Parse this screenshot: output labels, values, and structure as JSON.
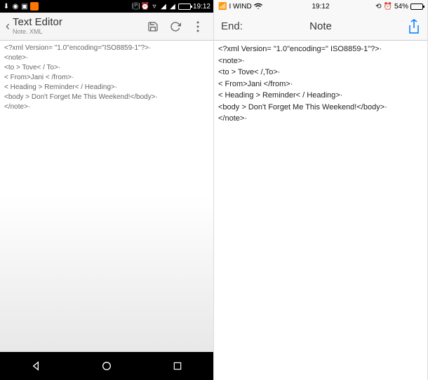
{
  "android": {
    "status": {
      "time": "19:12"
    },
    "appbar": {
      "title": "Text Editor",
      "subtitle": "Note. XML"
    },
    "content": {
      "lines": [
        "<?xml Version= \"1.0\"encoding=\"ISO8859-1\"?>·",
        "<note>·",
        " <to > Tove< / To>·",
        " < From>Jani < /from>·",
        " < Heading > Reminder< / Heading>·",
        " <body > Don't Forget Me This Weekend!</body>·",
        "</note>·"
      ]
    }
  },
  "ios": {
    "status": {
      "carrier": "I WIND",
      "time": "19:12",
      "battery": "54%"
    },
    "nav": {
      "back": "End:",
      "title": "Note"
    },
    "content": {
      "lines": [
        "<?xml Version= \"1.0\"encoding=\" ISO8859-1\"?>·",
        "<note>·",
        " <to > Tove< /,To>·",
        " < From>Jani </from>·",
        " < Heading > Reminder< / Heading>·",
        " <body > Don't Forget Me This Weekend!</body>·",
        "</note>·"
      ]
    }
  }
}
